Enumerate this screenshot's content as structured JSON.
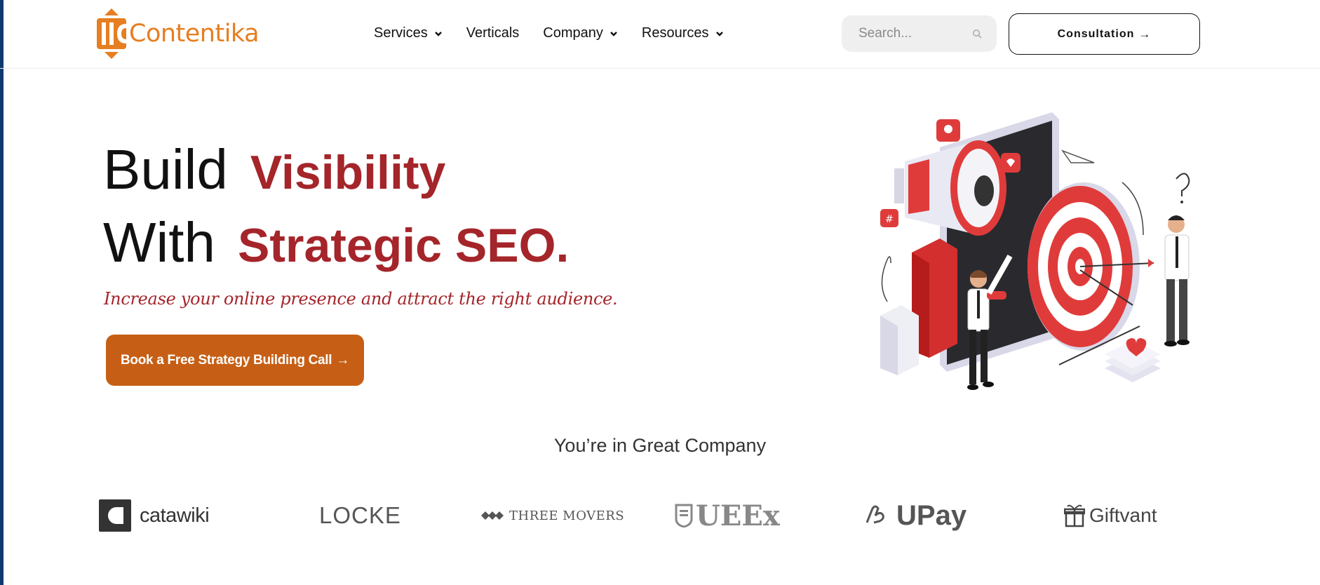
{
  "header": {
    "logo_text": "Contentika",
    "nav": [
      {
        "label": "Services",
        "has_dropdown": true
      },
      {
        "label": "Verticals",
        "has_dropdown": false
      },
      {
        "label": "Company",
        "has_dropdown": true
      },
      {
        "label": "Resources",
        "has_dropdown": true
      }
    ],
    "search": {
      "placeholder": "Search...",
      "icon": "search-icon"
    },
    "consultation_label": "Consultation",
    "consultation_arrow": "→"
  },
  "hero": {
    "line1_black": "Build",
    "line1_red": "Visibility",
    "line2_black": "With",
    "line2_red": "Strategic SEO.",
    "tagline": "Increase your online presence and attract the right audience.",
    "cta_label": "Book a Free Strategy Building Call",
    "cta_arrow": "→"
  },
  "clients": {
    "heading": "You’re in Great Company",
    "logos": [
      {
        "name": "catawiki"
      },
      {
        "name": "LOCKE"
      },
      {
        "name": "THREE MOVERS"
      },
      {
        "name": "UEEx"
      },
      {
        "name": "UPay"
      },
      {
        "name": "Giftvant"
      }
    ]
  },
  "colors": {
    "brand_orange": "#e67e22",
    "headline_red": "#a4252a",
    "cta_orange": "#c65f15",
    "left_edge_blue": "#0e3a6e"
  }
}
